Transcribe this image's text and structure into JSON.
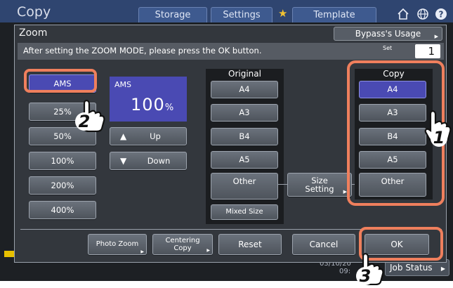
{
  "app": {
    "title": "Copy",
    "tabs": [
      "Storage",
      "Settings",
      "Template"
    ],
    "clock": [
      "03/10/20",
      "09:"
    ],
    "job_status_label": "Job Status"
  },
  "dialog": {
    "title": "Zoom",
    "bypass_label": "Bypass's Usage",
    "message": "After setting the ZOOM MODE, please press the OK button.",
    "set_label": "Set",
    "set_value": "1"
  },
  "zoom": {
    "buttons": [
      "AMS",
      "25%",
      "50%",
      "100%",
      "200%",
      "400%"
    ],
    "selected": "AMS",
    "display_label": "AMS",
    "display_value": "100",
    "display_unit": "%",
    "up_label": "Up",
    "down_label": "Down"
  },
  "original": {
    "title": "Original",
    "sizes": [
      "A4",
      "A3",
      "B4",
      "A5",
      "Other"
    ],
    "mixed_label": "Mixed Size"
  },
  "size_setting": {
    "line1": "Size",
    "line2": "Setting"
  },
  "copy": {
    "title": "Copy",
    "sizes": [
      "A4",
      "A3",
      "B4",
      "A5",
      "Other"
    ],
    "selected": "A4"
  },
  "bottom": {
    "photo_zoom": "Photo Zoom",
    "centering_line1": "Centering",
    "centering_line2": "Copy",
    "reset": "Reset",
    "cancel": "Cancel",
    "ok": "OK"
  },
  "callouts": [
    "1",
    "2",
    "3"
  ],
  "colors": {
    "highlight": "#ef7f5d",
    "selected": "#4a4ab3",
    "topbar": "#2f4570"
  }
}
